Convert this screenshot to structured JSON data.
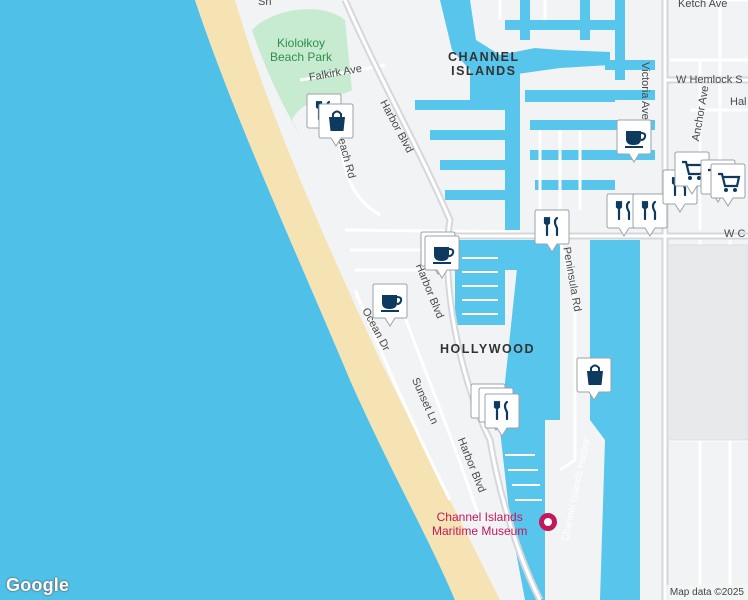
{
  "map": {
    "area_labels": [
      {
        "id": "channel-islands",
        "text": "CHANNEL\nISLANDS"
      },
      {
        "id": "hollywood",
        "text": "HOLLYWOOD"
      }
    ],
    "park_label": "Kiolołkoy\nBeach Park",
    "poi_label": "Channel Islands\nMaritime Museum",
    "water_label": "Channel Islands Harbor",
    "streets": {
      "ketch_ave": "Ketch Ave",
      "victoria_ave": "Victoria Ave",
      "w_hemlock": "W Hemlock S",
      "anchor_ave": "Anchor Ave",
      "hal": "Hal",
      "falkirk_ave": "Falkirk Ave",
      "beach_rd": "Beach Rd",
      "harbor_blvd_1": "Harbor Blvd",
      "harbor_blvd_2": "Harbor Blvd",
      "harbor_blvd_3": "Harbor Blvd",
      "w_c": "W C",
      "peninsula_rd": "Peninsula Rd",
      "ocean_dr": "Ocean Dr",
      "sunset_ln": "Sunset Ln",
      "sh": "Sh"
    },
    "google_logo": "Google",
    "attribution": "Map data ©2025"
  },
  "colors": {
    "ocean": "#4fc1e9",
    "sand": "#f6e3b4",
    "land": "#f2f3f4",
    "park": "#c7ebd0",
    "road": "#ffffff",
    "highway": "#d5d7db",
    "marker_fill": "#0d3a5e",
    "marker_bg": "#ffffff"
  },
  "markers": [
    {
      "type": "restaurant-icon"
    },
    {
      "type": "shopping-icon"
    },
    {
      "type": "coffee-icon"
    },
    {
      "type": "coffee-icon"
    },
    {
      "type": "coffee-icon"
    },
    {
      "type": "restaurant-icon"
    },
    {
      "type": "restaurant-icon"
    },
    {
      "type": "restaurant-icon"
    },
    {
      "type": "restaurant-icon"
    },
    {
      "type": "coffee-icon"
    },
    {
      "type": "grocery-cart-icon"
    },
    {
      "type": "grocery-cart-icon"
    },
    {
      "type": "restaurant-icon"
    },
    {
      "type": "restaurant-icon"
    },
    {
      "type": "restaurant-icon"
    },
    {
      "type": "shopping-icon"
    },
    {
      "type": "grocery-cart-icon"
    }
  ]
}
